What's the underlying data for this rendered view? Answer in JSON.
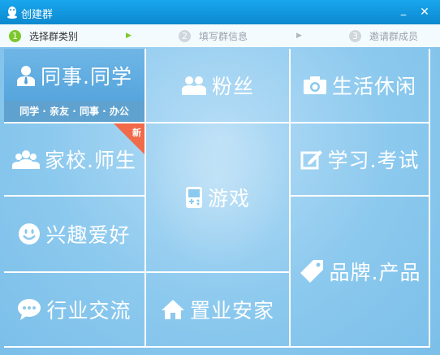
{
  "window": {
    "title": "创建群",
    "min_icon": "minimize-icon",
    "close_icon": "close-icon"
  },
  "steps": [
    {
      "num": "1",
      "label": "选择群类别",
      "active": true
    },
    {
      "num": "2",
      "label": "填写群信息",
      "active": false
    },
    {
      "num": "3",
      "label": "邀请群成员",
      "active": false
    }
  ],
  "step_arrow": "▶",
  "categories": {
    "colleague": {
      "label": "同事.同学",
      "subtitle": "同学 · 亲友 · 同事 · 办公",
      "icon": "person-icon"
    },
    "fans": {
      "label": "粉丝",
      "icon": "people-icon"
    },
    "life": {
      "label": "生活休闲",
      "icon": "camera-icon"
    },
    "school": {
      "label": "家校.师生",
      "icon": "group-icon",
      "badge": "新"
    },
    "game": {
      "label": "游戏",
      "icon": "gamepad-icon"
    },
    "study": {
      "label": "学习.考试",
      "icon": "edit-icon"
    },
    "hobby": {
      "label": "兴趣爱好",
      "icon": "smile-icon"
    },
    "brand": {
      "label": "品牌.产品",
      "icon": "tag-icon"
    },
    "industry": {
      "label": "行业交流",
      "icon": "chat-bubble-icon"
    },
    "realestate": {
      "label": "置业安家",
      "icon": "home-icon"
    }
  },
  "colors": {
    "accent": "#0b89cf",
    "tile_bg": "#8cc9ee",
    "selected": "#4c9ed9",
    "badge": "#f16a4a",
    "step_active": "#7cc82a"
  }
}
